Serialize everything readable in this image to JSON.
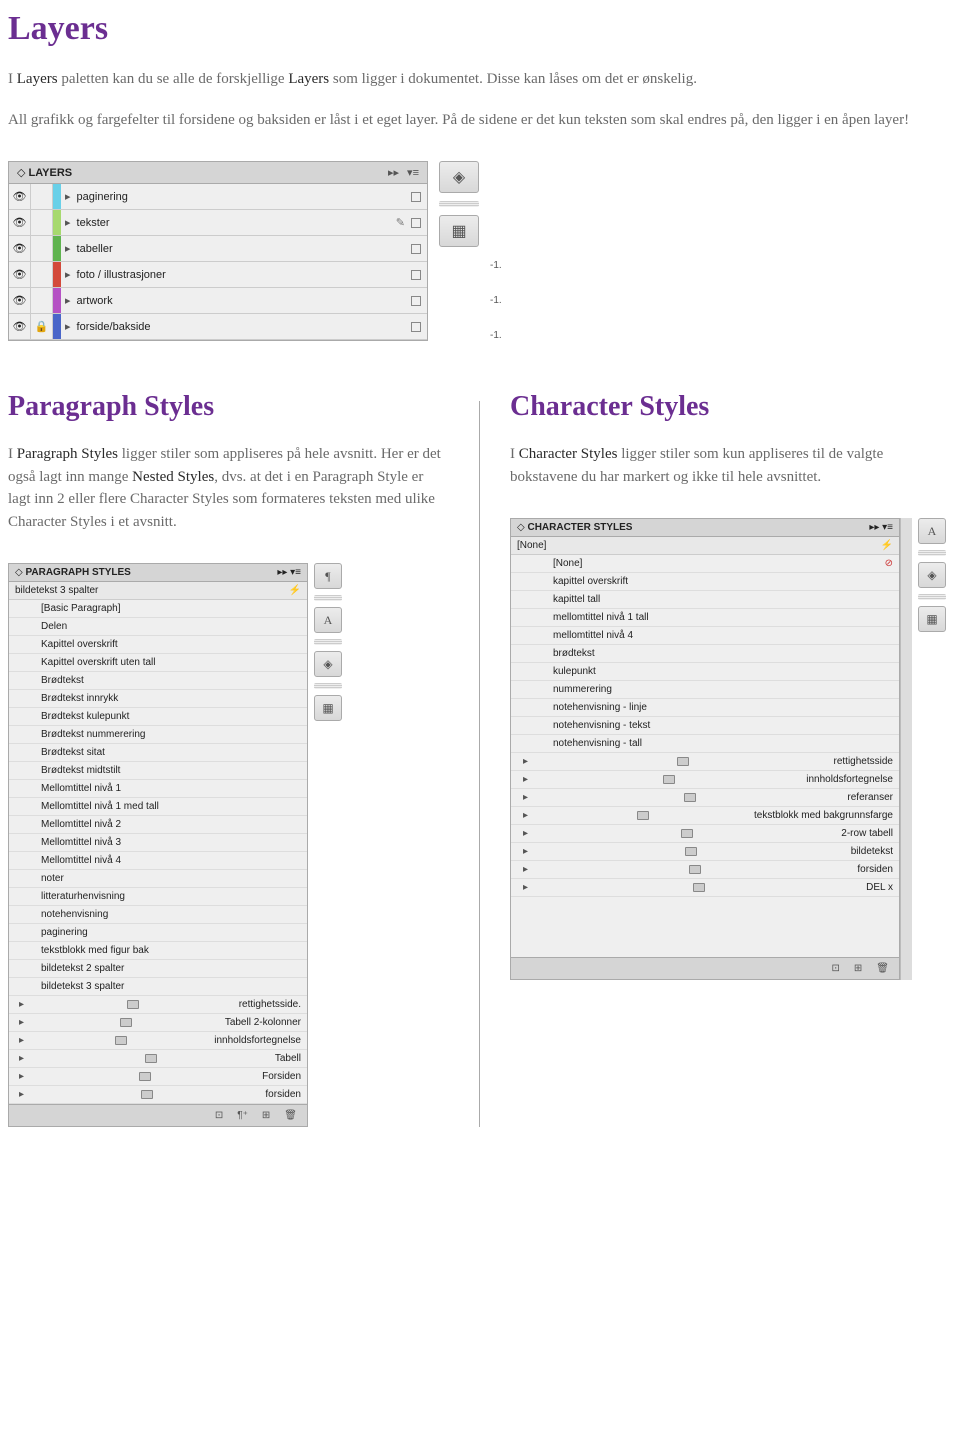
{
  "sections": {
    "layers": {
      "heading": "Layers",
      "p1_parts": [
        "I ",
        "Layers",
        " paletten kan du se alle de forskjellige ",
        "Layers",
        " som ligger i dokumentet. Disse kan låses om det er ønskelig."
      ],
      "p2": "All grafikk og fargefelter til forsidene og baksiden er låst i et eget layer. På de sidene er det kun teksten som skal endres på, den ligger i en åpen layer!"
    },
    "paragraph": {
      "heading": "Paragraph Styles",
      "p_parts": [
        "I ",
        "Paragraph Styles",
        " ligger stiler som appliseres på hele avsnitt. Her er det også lagt inn mange ",
        "Nested Styles",
        ", dvs. at det i en Paragraph Style er lagt inn 2 eller flere Character Styles som formateres teksten med ulike Character Styles i et avsnitt."
      ]
    },
    "character": {
      "heading": "Character Styles",
      "p_parts": [
        "I ",
        "Character Styles",
        " ligger stiler som kun appliseres til de valgte bokstavene du har markert og ikke til hele avsnittet."
      ]
    }
  },
  "layers_panel": {
    "title": "LAYERS",
    "rows": [
      {
        "color": "#69d0e8",
        "name": "paginering",
        "locked": false,
        "pen": false
      },
      {
        "color": "#a7d96f",
        "name": "tekster",
        "locked": false,
        "pen": true
      },
      {
        "color": "#5fb34f",
        "name": "tabeller",
        "locked": false,
        "pen": false
      },
      {
        "color": "#d34a3a",
        "name": "foto / illustrasjoner",
        "locked": false,
        "pen": false
      },
      {
        "color": "#b552c4",
        "name": "artwork",
        "locked": false,
        "pen": false
      },
      {
        "color": "#4a66c9",
        "name": "forside/bakside",
        "locked": true,
        "pen": false
      }
    ],
    "ruler_marks": [
      "-1.",
      "-1.",
      "-1."
    ]
  },
  "paragraph_panel": {
    "title": "PARAGRAPH STYLES",
    "current": "bildetekst 3 spalter",
    "items": [
      "[Basic Paragraph]",
      "Delen",
      "Kapittel overskrift",
      "Kapittel overskrift uten tall",
      "Brødtekst",
      "Brødtekst innrykk",
      "Brødtekst kulepunkt",
      "Brødtekst nummerering",
      "Brødtekst sitat",
      "Brødtekst midtstilt",
      "Mellomtittel nivå 1",
      "Mellomtittel nivå 1 med tall",
      "Mellomtittel nivå 2",
      "Mellomtittel nivå 3",
      "Mellomtittel nivå 4",
      "noter",
      "litteraturhenvisning",
      "notehenvisning",
      "paginering",
      "tekstblokk med figur bak",
      "bildetekst 2 spalter",
      "bildetekst 3 spalter"
    ],
    "folders": [
      "rettighetsside.",
      "Tabell 2-kolonner",
      "innholdsfortegnelse",
      "Tabell",
      "Forsiden",
      "forsiden"
    ]
  },
  "character_panel": {
    "title": "CHARACTER STYLES",
    "current": "[None]",
    "items": [
      "[None]",
      "kapittel overskrift",
      "kapittel tall",
      "mellomtittel nivå 1 tall",
      "mellomtittel nivå 4",
      "brødtekst",
      "kulepunkt",
      "nummerering",
      "notehenvisning - linje",
      "notehenvisning - tekst",
      "notehenvisning - tall"
    ],
    "folders": [
      "rettighetsside",
      "innholdsfortegnelse",
      "referanser",
      "tekstblokk med bakgrunnsfarge",
      "2-row tabell",
      "bildetekst",
      "forsiden",
      "DEL x"
    ]
  }
}
